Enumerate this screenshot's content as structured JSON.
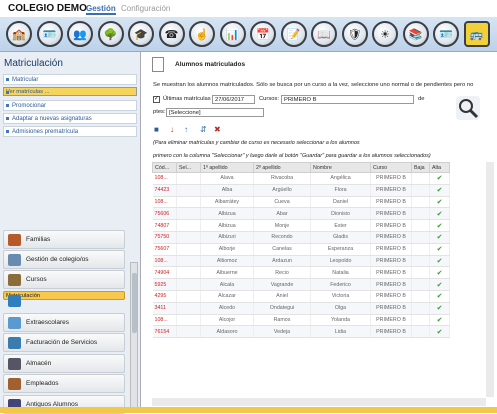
{
  "header": {
    "title": "COLEGIO DEMO",
    "tab_active": "Gestión",
    "tab_other": "Configuración"
  },
  "toolbar_icons": [
    "school-icon",
    "id-card-icon",
    "students-icon",
    "tree-icon",
    "graduate-icon",
    "phone-icon",
    "finger-icon",
    "presentation-icon",
    "calendar-icon",
    "notepad-icon",
    "book-icon",
    "shield-icon",
    "sun-icon",
    "books-icon",
    "id-badge-icon",
    "bus-icon"
  ],
  "sidebar": {
    "title": "Matriculación",
    "items": [
      "Matricular",
      "Ver matrículas ...",
      "Promocionar",
      "Adaptar a nuevas asignaturas",
      "Admisiones prematrícula"
    ],
    "modules": [
      "Familias",
      "Gestión de colegio/os",
      "Cursos",
      "Matriculación",
      "Extraescolares",
      "Facturación de Servicios",
      "Almacén",
      "Empleados",
      "Antiguos Alumnos"
    ]
  },
  "main": {
    "title": "Alumnos matriculados",
    "info": "Se muestran los alumnos matriculados. Sólo se busca por un curso a la vez, seleccione uno normal o de pendientes pero no",
    "ultimas_label": "Últimas matrículas",
    "ultimas_value": "27/06/2017",
    "cursos_label": "Cursos:",
    "cursos_value": "PRIMERO B",
    "de_label": "de",
    "ptes_label": "ptes:",
    "ptes_value": "[Seleccione]",
    "note1": "(Para eliminar matrículas y cambiar de curso es necesario seleccionar a los alumnos",
    "note2": "primero con la columna \"Seleccionar\" y luego darle al botón \"Guardar\" para guardar a los alumnos seleccionados)",
    "columns": [
      "Cód...",
      "Sel...",
      "1º apellido",
      "2º apellido",
      "Nombre",
      "Curso",
      "Baja",
      "Alta"
    ],
    "rows": [
      [
        "108...",
        "Alava",
        "Rivacoba",
        "Angélica",
        "PRIMERO B"
      ],
      [
        "74423",
        "Alba",
        "Argüello",
        "Flora",
        "PRIMERO B"
      ],
      [
        "108...",
        "Albarrátey",
        "Cueva",
        "Daniel",
        "PRIMERO B"
      ],
      [
        "75606",
        "Albizua",
        "Abar",
        "Dionisio",
        "PRIMERO B"
      ],
      [
        "74807",
        "Albizua",
        "Monje",
        "Ester",
        "PRIMERO B"
      ],
      [
        "75750",
        "Albizuri",
        "Recondo",
        "Gladis",
        "PRIMERO B"
      ],
      [
        "75607",
        "Alborje",
        "Canelas",
        "Esperanza",
        "PRIMERO B"
      ],
      [
        "108...",
        "Altiomoz",
        "Ardazun",
        "Leopoldo",
        "PRIMERO B"
      ],
      [
        "74904",
        "Albuerne",
        "Recio",
        "Natalia",
        "PRIMERO B"
      ],
      [
        "5925",
        "Alcala",
        "Vagrande",
        "Federico",
        "PRIMERO B"
      ],
      [
        "4295",
        "Alcazar",
        "Aniel",
        "Victoria",
        "PRIMERO B"
      ],
      [
        "3411",
        "Alcedo",
        "Ondategui",
        "Olga",
        "PRIMERO B"
      ],
      [
        "108...",
        "Alcojor",
        "Ramos",
        "Yolanda",
        "PRIMERO B"
      ],
      [
        "76154",
        "Aldasoro",
        "Vedeja",
        "Lidia",
        "PRIMERO B"
      ]
    ]
  },
  "colors": {
    "accent": "#3a6fb5",
    "selected": "#f6d35a",
    "code": "#d02020"
  }
}
